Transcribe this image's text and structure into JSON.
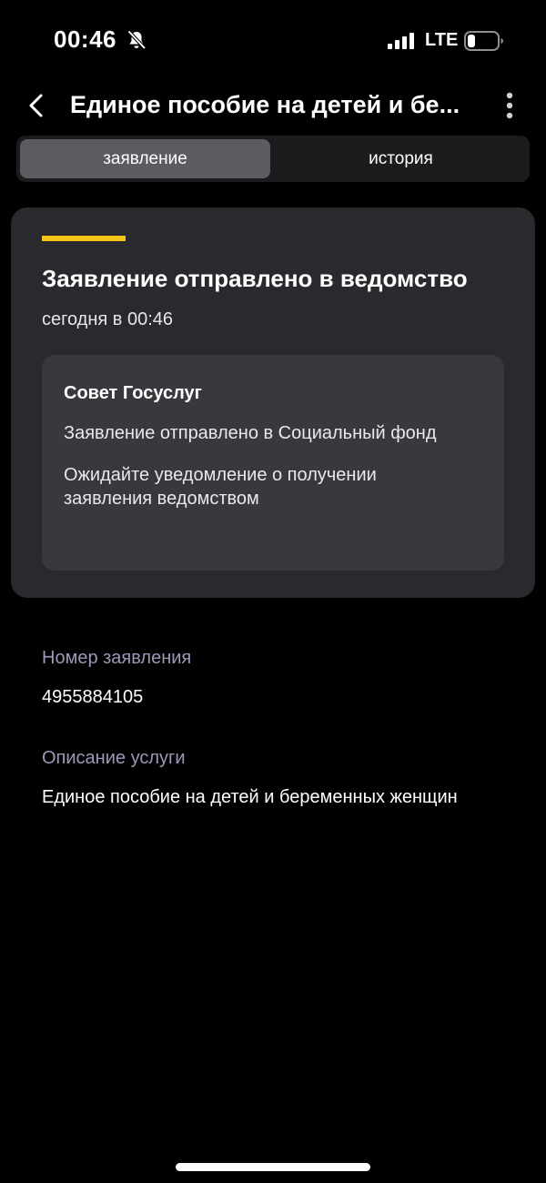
{
  "status_bar": {
    "time": "00:46",
    "network": "LTE",
    "icons": [
      "bell-muted-icon",
      "signal-icon",
      "battery-icon"
    ]
  },
  "header": {
    "title": "Единое пособие на детей и бе...",
    "back_icon": "chevron-left-icon",
    "menu_icon": "vertical-dots-icon"
  },
  "tabs": [
    {
      "label": "заявление",
      "active": true
    },
    {
      "label": "история",
      "active": false
    }
  ],
  "status_card": {
    "accent_color": "#f5c518",
    "title": "Заявление отправлено в ведомство",
    "time": "сегодня в 00:46",
    "advice": {
      "title": "Совет Госуслуг",
      "line1": "Заявление отправлено в Социальный фонд",
      "line2": "Ожидайте уведомление о получении заявления ведомством"
    }
  },
  "fields": {
    "number_label": "Номер заявления",
    "number_value": "4955884105",
    "description_label": "Описание услуги",
    "description_value": "Единое пособие на детей и беременных женщин"
  },
  "colors": {
    "background": "#000000",
    "card": "#2a2a2e",
    "inner_card": "#38383d",
    "muted_label": "#9a9ab8",
    "active_tab": "#5b5b60"
  }
}
